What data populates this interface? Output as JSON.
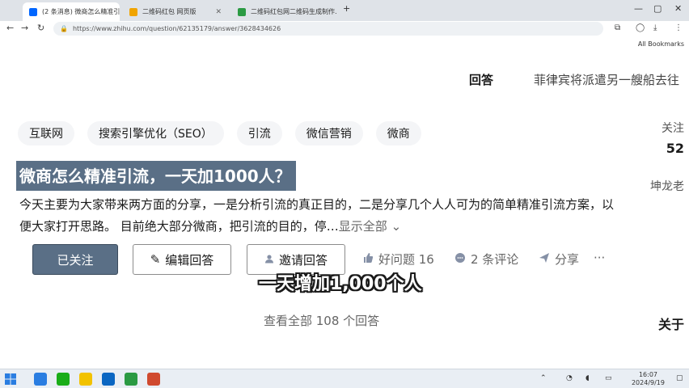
{
  "browser": {
    "tabs": [
      {
        "label": "(2 条消息) 微商怎么精准引流…",
        "active": true,
        "favicon_color": "#0066ff"
      },
      {
        "label": "二维码红包 网页版",
        "active": false,
        "favicon_color": "#f0a400"
      },
      {
        "label": "二维码红包网二维码生成制作…",
        "active": false,
        "favicon_color": "#2b9a43"
      }
    ],
    "new_tab": "+",
    "window_controls": {
      "minimize": "—",
      "maximize": "▢",
      "close": "✕"
    },
    "url": "https://www.zhihu.com/question/62135179/answer/3628434626",
    "bookmarks_label": "All Bookmarks"
  },
  "header": {
    "sticky_label": "回答",
    "sticky_question": "菲律宾将派遣另一艘船去往"
  },
  "sidebar": {
    "follow_label": "关注",
    "count": "52",
    "name": "坤龙老",
    "related": "关于"
  },
  "question": {
    "topics": [
      "互联网",
      "搜索引擎优化（SEO）",
      "引流",
      "微信营销",
      "微商"
    ],
    "title": "微商怎么精准引流，一天加1000人？",
    "excerpt": "今天主要为大家带来两方面的分享，一是分析引流的真正目的，二是分享几个人人可为的简单精准引流方案，以便大家打开思路。 目前绝大部分微商，把引流的目的，停…",
    "show_all": "显示全部"
  },
  "actions": {
    "follow": "已关注",
    "write_answer": "编辑回答",
    "invite": "邀请回答",
    "good_question": "好问题 16",
    "comments": "2 条评论",
    "share": "分享",
    "more": "···"
  },
  "caption": "一天增加1,000个人",
  "answers_link": "查看全部 108 个回答",
  "taskbar": {
    "time": "16:07",
    "date": "2024/9/19",
    "apps": [
      "#2a7de1",
      "#1aad19",
      "#f2c200",
      "#0a66c2",
      "#2b9a43",
      "#d04a2f"
    ]
  },
  "colors": {
    "accent": "#5a6f86",
    "caption_fill": "#ffffff",
    "caption_stroke": "#1a1a1a"
  }
}
